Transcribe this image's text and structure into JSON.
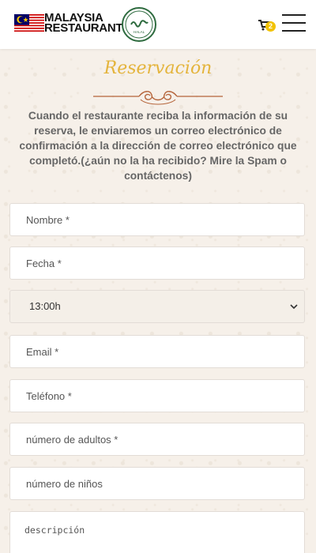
{
  "header": {
    "brand_line1": "MALAYSIA",
    "brand_line2": "RESTAURANT",
    "halal_text": "HALAL",
    "cart_count": "2",
    "icons": [
      "malaysia-flag-icon",
      "halal-logo-icon",
      "cart-icon",
      "hamburger-menu-icon"
    ]
  },
  "page": {
    "title": "Reservación",
    "intro": "Cuando el restaurante reciba la información de su reserva, le enviaremos un correo electrónico de confirmación a la dirección de correo electrónico que completó.(¿aún no la ha recibido? Mire la Spam o contáctenos)"
  },
  "form": {
    "name_placeholder": "Nombre *",
    "date_placeholder": "Fecha *",
    "time_selected": "13:00h",
    "email_placeholder": "Email *",
    "phone_placeholder": "Teléfono *",
    "adults_placeholder": "número de adultos *",
    "children_placeholder": "número de niños",
    "description_placeholder": "descripción"
  },
  "colors": {
    "accent_gold": "#e4b43c",
    "ornament": "#b5643a",
    "badge": "#f2c200",
    "background": "#f6f0e9"
  }
}
